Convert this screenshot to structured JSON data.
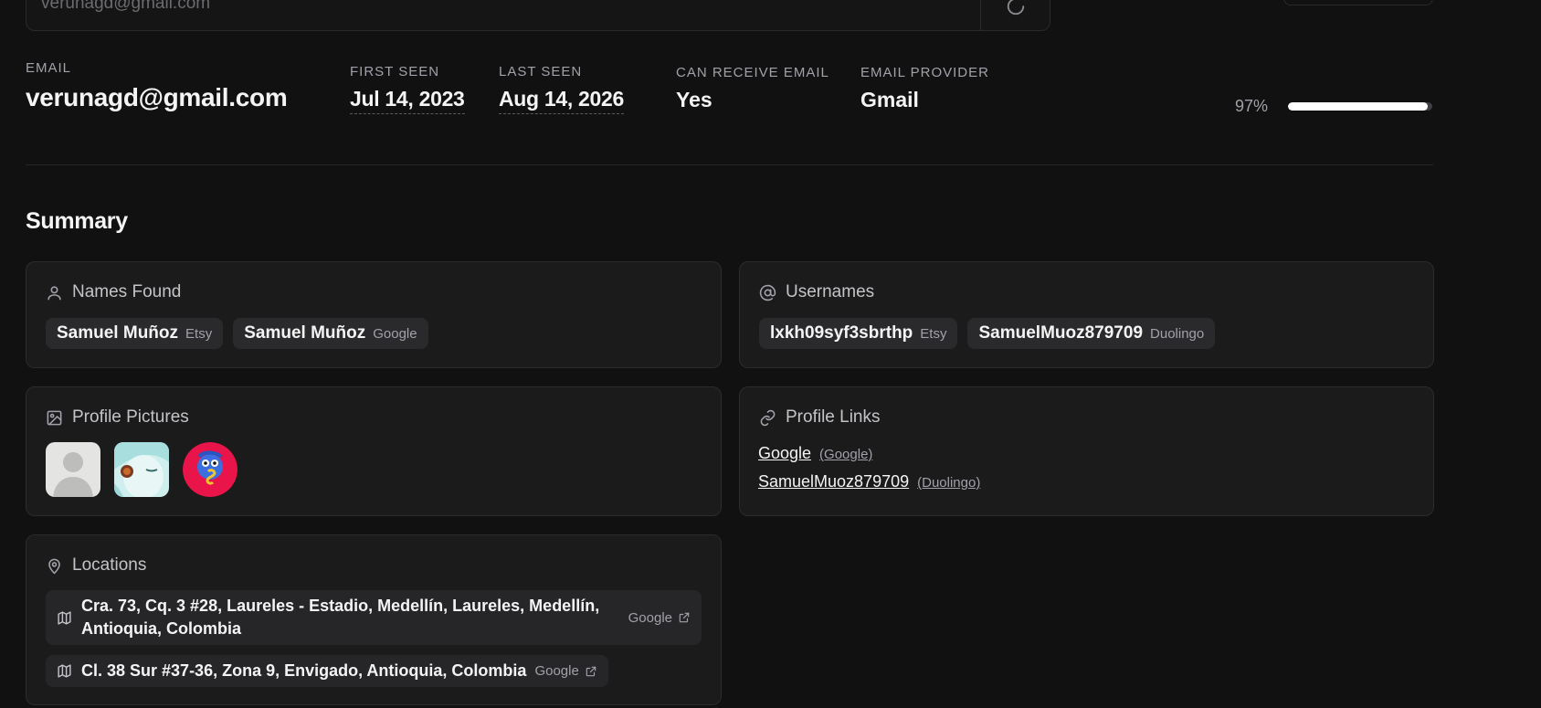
{
  "search": {
    "value": "verunagd@gmail.com",
    "refresh_icon": "refresh-icon"
  },
  "stats": {
    "email": {
      "label": "EMAIL",
      "value": "verunagd@gmail.com"
    },
    "first_seen": {
      "label": "FIRST SEEN",
      "value": "Jul 14, 2023"
    },
    "last_seen": {
      "label": "LAST SEEN",
      "value": "Aug 14, 2026"
    },
    "can_receive": {
      "label": "CAN RECEIVE EMAIL",
      "value": "Yes"
    },
    "provider": {
      "label": "EMAIL PROVIDER",
      "value": "Gmail"
    },
    "score": {
      "label": "97%",
      "value": 0.97
    }
  },
  "summary": {
    "title": "Summary",
    "names": {
      "title": "Names Found",
      "icon": "user-icon",
      "items": [
        {
          "name": "Samuel Muñoz",
          "source": "Etsy"
        },
        {
          "name": "Samuel Muñoz",
          "source": "Google"
        }
      ]
    },
    "usernames": {
      "title": "Usernames",
      "icon": "at-sign-icon",
      "items": [
        {
          "name": "lxkh09syf3sbrthp",
          "source": "Etsy"
        },
        {
          "name": "SamuelMuoz879709",
          "source": "Duolingo"
        }
      ]
    },
    "pictures": {
      "title": "Profile Pictures",
      "icon": "image-icon",
      "items": [
        "default-profile-avatar",
        "anime-girl-avatar",
        "duolingo-avatar"
      ]
    },
    "links": {
      "title": "Profile Links",
      "icon": "link-icon",
      "items": [
        {
          "label": "Google",
          "source": "(Google)"
        },
        {
          "label": "SamuelMuoz879709",
          "source": "(Duolingo)"
        }
      ]
    },
    "locations": {
      "title": "Locations",
      "icon": "map-pin-icon",
      "items": [
        {
          "address": "Cra. 73, Cq. 3 #28, Laureles - Estadio, Medellín, Laureles, Medellín, Antioquia, Colombia",
          "source": "Google"
        },
        {
          "address": "Cl. 38 Sur #37-36, Zona 9, Envigado, Antioquia, Colombia",
          "source": "Google"
        }
      ]
    }
  },
  "colors": {
    "background": "#111111",
    "card": "#1b1b1c",
    "chip": "#2a2a2c",
    "accent": "#ffffff"
  }
}
